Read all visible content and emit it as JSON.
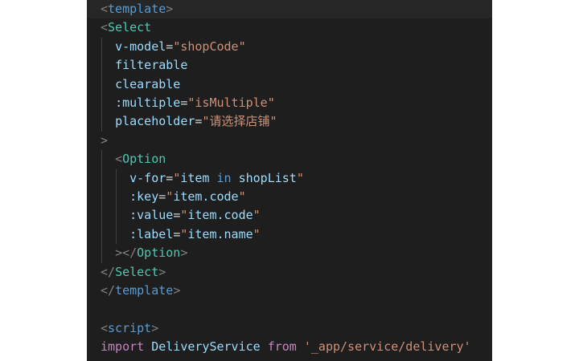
{
  "editor": {
    "colors": {
      "background": "#1e1e1e",
      "punctuation": "#808080",
      "tag": "#569cd6",
      "component": "#4ec9b0",
      "attribute": "#9cdcfe",
      "string": "#ce9178",
      "control_keyword": "#c586c0"
    },
    "lines": [
      {
        "tokens": [
          {
            "t": "<",
            "c": "t-punc"
          },
          {
            "t": "template",
            "c": "t-tag"
          },
          {
            "t": ">",
            "c": "t-punc"
          }
        ]
      },
      {
        "tokens": [
          {
            "t": "<",
            "c": "t-punc"
          },
          {
            "t": "Select",
            "c": "t-comp"
          }
        ]
      },
      {
        "tokens": [
          {
            "t": "  "
          },
          {
            "t": "v-model",
            "c": "t-attr"
          },
          {
            "t": "=",
            "c": "t-plain"
          },
          {
            "t": "\"shopCode\"",
            "c": "t-str"
          }
        ]
      },
      {
        "tokens": [
          {
            "t": "  "
          },
          {
            "t": "filterable",
            "c": "t-attr"
          }
        ]
      },
      {
        "tokens": [
          {
            "t": "  "
          },
          {
            "t": "clearable",
            "c": "t-attr"
          }
        ]
      },
      {
        "tokens": [
          {
            "t": "  "
          },
          {
            "t": ":multiple",
            "c": "t-attr"
          },
          {
            "t": "=",
            "c": "t-plain"
          },
          {
            "t": "\"isMultiple\"",
            "c": "t-str"
          }
        ]
      },
      {
        "tokens": [
          {
            "t": "  "
          },
          {
            "t": "placeholder",
            "c": "t-attr"
          },
          {
            "t": "=",
            "c": "t-plain"
          },
          {
            "t": "\"请选择店铺\"",
            "c": "t-str"
          }
        ]
      },
      {
        "tokens": [
          {
            "t": ">",
            "c": "t-punc"
          }
        ]
      },
      {
        "tokens": [
          {
            "t": "  "
          },
          {
            "t": "<",
            "c": "t-punc"
          },
          {
            "t": "Option",
            "c": "t-comp"
          }
        ]
      },
      {
        "tokens": [
          {
            "t": "    "
          },
          {
            "t": "v-for",
            "c": "t-attr"
          },
          {
            "t": "=",
            "c": "t-plain"
          },
          {
            "t": "\"",
            "c": "t-str"
          },
          {
            "t": "item",
            "c": "t-id"
          },
          {
            "t": " in ",
            "c": "t-kw"
          },
          {
            "t": "shopList",
            "c": "t-id"
          },
          {
            "t": "\"",
            "c": "t-str"
          }
        ]
      },
      {
        "tokens": [
          {
            "t": "    "
          },
          {
            "t": ":key",
            "c": "t-attr"
          },
          {
            "t": "=",
            "c": "t-plain"
          },
          {
            "t": "\"",
            "c": "t-str"
          },
          {
            "t": "item.code",
            "c": "t-id"
          },
          {
            "t": "\"",
            "c": "t-str"
          }
        ]
      },
      {
        "tokens": [
          {
            "t": "    "
          },
          {
            "t": ":value",
            "c": "t-attr"
          },
          {
            "t": "=",
            "c": "t-plain"
          },
          {
            "t": "\"",
            "c": "t-str"
          },
          {
            "t": "item.code",
            "c": "t-id"
          },
          {
            "t": "\"",
            "c": "t-str"
          }
        ]
      },
      {
        "tokens": [
          {
            "t": "    "
          },
          {
            "t": ":label",
            "c": "t-attr"
          },
          {
            "t": "=",
            "c": "t-plain"
          },
          {
            "t": "\"",
            "c": "t-str"
          },
          {
            "t": "item.name",
            "c": "t-id"
          },
          {
            "t": "\"",
            "c": "t-str"
          }
        ]
      },
      {
        "tokens": [
          {
            "t": "  "
          },
          {
            "t": "></",
            "c": "t-punc"
          },
          {
            "t": "Option",
            "c": "t-comp"
          },
          {
            "t": ">",
            "c": "t-punc"
          }
        ]
      },
      {
        "tokens": [
          {
            "t": "</",
            "c": "t-punc"
          },
          {
            "t": "Select",
            "c": "t-comp"
          },
          {
            "t": ">",
            "c": "t-punc"
          }
        ]
      },
      {
        "tokens": [
          {
            "t": "</",
            "c": "t-punc"
          },
          {
            "t": "template",
            "c": "t-tag"
          },
          {
            "t": ">",
            "c": "t-punc"
          }
        ]
      },
      {
        "tokens": []
      },
      {
        "tokens": [
          {
            "t": "<",
            "c": "t-punc"
          },
          {
            "t": "script",
            "c": "t-tag"
          },
          {
            "t": ">",
            "c": "t-punc"
          }
        ]
      },
      {
        "tokens": [
          {
            "t": "import",
            "c": "t-ctrl"
          },
          {
            "t": " "
          },
          {
            "t": "DeliveryService",
            "c": "t-id"
          },
          {
            "t": " "
          },
          {
            "t": "from",
            "c": "t-ctrl"
          },
          {
            "t": " "
          },
          {
            "t": "'_app/service/delivery'",
            "c": "t-str"
          }
        ]
      }
    ]
  }
}
